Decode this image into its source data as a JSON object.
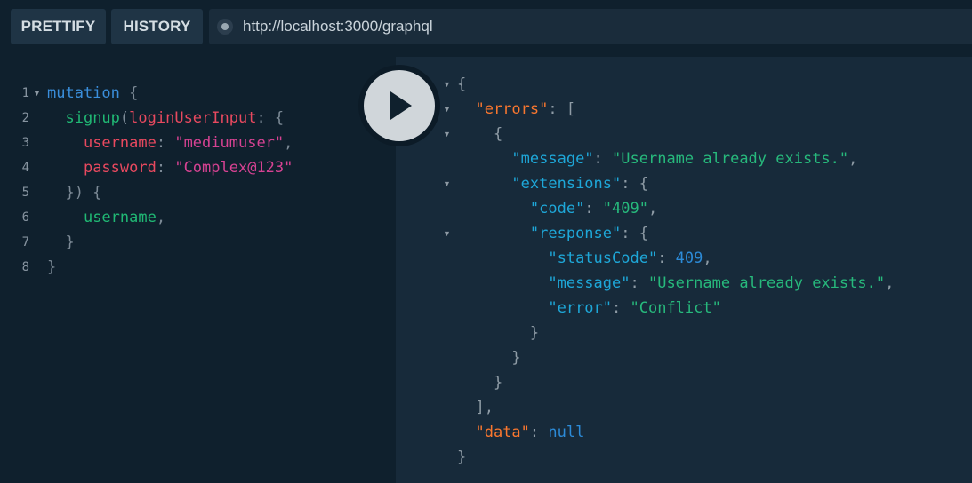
{
  "toolbar": {
    "prettify_label": "PRETTIFY",
    "history_label": "HISTORY",
    "url": "http://localhost:3000/graphql"
  },
  "editor": {
    "line_numbers": [
      "1",
      "2",
      "3",
      "4",
      "5",
      "6",
      "7",
      "8"
    ],
    "query": {
      "keyword": "mutation",
      "field": "signup",
      "argument": "loginUserInput",
      "username_key": "username",
      "username_value": "\"mediumuser\"",
      "password_key": "password",
      "password_value": "\"Complex@123\"",
      "selection_field": "username"
    }
  },
  "results": {
    "errors_key": "\"errors\"",
    "message_key": "\"message\"",
    "message_value": "\"Username already exists.\"",
    "extensions_key": "\"extensions\"",
    "code_key": "\"code\"",
    "code_value": "\"409\"",
    "response_key": "\"response\"",
    "status_code_key": "\"statusCode\"",
    "status_code_value": "409",
    "response_message_key": "\"message\"",
    "response_message_value": "\"Username already exists.\"",
    "error_key": "\"error\"",
    "error_value": "\"Conflict\"",
    "data_key": "\"data\"",
    "data_value": "null"
  },
  "colors": {
    "background": "#172a3a",
    "editor_background": "#0f202d",
    "keyword": "#3a8edb",
    "string": "#d64292",
    "json_string": "#27b97c",
    "json_key": "#1ea7d8"
  },
  "icons": {
    "play": "play-icon",
    "connection_status": "status-dot-icon",
    "fold": "fold-arrow-icon"
  }
}
